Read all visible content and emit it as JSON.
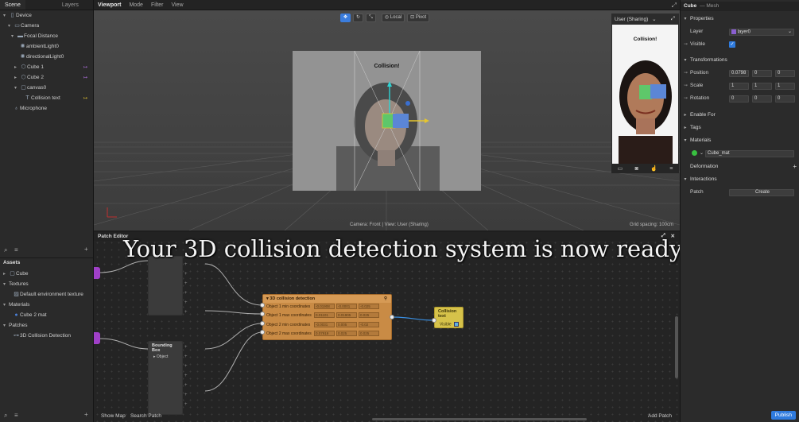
{
  "left": {
    "tabs": [
      "Scene",
      "Layers"
    ],
    "scene_tree": [
      {
        "label": "Device",
        "icon": "device-icon",
        "caret": "▾",
        "badge": ""
      },
      {
        "label": "Camera",
        "icon": "camera-icon",
        "caret": "▾",
        "badge": ""
      },
      {
        "label": "Focal Distance",
        "icon": "focal-icon",
        "caret": "▾",
        "badge": ""
      },
      {
        "label": "ambientLight0",
        "icon": "light-icon",
        "caret": "",
        "badge": ""
      },
      {
        "label": "directionalLight0",
        "icon": "light-icon",
        "caret": "",
        "badge": ""
      },
      {
        "label": "Cube 1",
        "icon": "cube-icon",
        "caret": "▸",
        "badge": "↦"
      },
      {
        "label": "Cube 2",
        "icon": "cube-icon",
        "caret": "▸",
        "badge": "↦"
      },
      {
        "label": "canvas0",
        "icon": "canvas-icon",
        "caret": "▾",
        "badge": ""
      },
      {
        "label": "Collision text",
        "icon": "text-icon",
        "caret": "",
        "badge": "↦"
      },
      {
        "label": "Microphone",
        "icon": "microphone-icon",
        "caret": "",
        "badge": ""
      }
    ],
    "assets_title": "Assets",
    "assets_tree": [
      {
        "label": "Cube",
        "caret": "▸",
        "icon": "folder-icon"
      },
      {
        "label": "Textures",
        "caret": "▾",
        "icon": ""
      },
      {
        "label": "Default environment texture",
        "caret": "",
        "icon": "texture-icon"
      },
      {
        "label": "Materials",
        "caret": "▾",
        "icon": ""
      },
      {
        "label": "Cube 2 mat",
        "caret": "",
        "icon": "material-icon"
      },
      {
        "label": "Patches",
        "caret": "▾",
        "icon": ""
      },
      {
        "label": "3D Collision Detection",
        "caret": "",
        "icon": "patch-icon"
      }
    ]
  },
  "topbar": {
    "menus": [
      "Viewport",
      "Mode",
      "Filter",
      "View"
    ]
  },
  "viewport": {
    "toolbar": {
      "local": "Local",
      "pivot": "Pivot"
    },
    "camera_label": "Collision!",
    "status": "Camera: Front | View: User (Sharing)",
    "grid_spacing": "Grid spacing: 100cm"
  },
  "preview": {
    "device": "User (Sharing)",
    "label": "Collision!"
  },
  "patch": {
    "title": "Patch Editor",
    "caption": "Your 3D collision detection system is now ready!",
    "bounding_box": {
      "title": "Bounding Box",
      "port": "Object"
    },
    "collision_node": {
      "title": "3D collision detection",
      "ports": [
        {
          "label": "Object 1 min coordinates",
          "values": [
            "-0.01908",
            "-0.0001",
            "-0.025"
          ]
        },
        {
          "label": "Object 1 max coordinates",
          "values": [
            "0.01101",
            "0.01905",
            "0.025"
          ]
        },
        {
          "label": "Object 2 min coordinates",
          "values": [
            "-0.0031",
            "0.005",
            "-0.02"
          ]
        },
        {
          "label": "Object 2 max coordinates",
          "values": [
            "0.07919",
            "0.025",
            "0.025"
          ]
        }
      ]
    },
    "collision_text_node": {
      "title": "Collision text",
      "port": "Visible"
    },
    "footer": {
      "show_map": "Show Map",
      "search_patch": "Search Patch",
      "add_patch": "Add Patch"
    }
  },
  "right": {
    "object_name": "Cube",
    "object_type": "— Mesh",
    "sections": {
      "properties": "Properties",
      "transformations": "Transformations",
      "enable_for": "Enable For",
      "tags": "Tags",
      "materials": "Materials",
      "deformation": "Deformation",
      "interactions": "Interactions"
    },
    "layer_label": "Layer",
    "layer_value": "layer0",
    "visible_label": "Visible",
    "position_label": "Position",
    "position": [
      "0.0798",
      "0",
      "0"
    ],
    "scale_label": "Scale",
    "scale": [
      "1",
      "1",
      "1"
    ],
    "rotation_label": "Rotation",
    "rotation": [
      "0",
      "0",
      "0"
    ],
    "material_value": "Cube_mat",
    "patch_label": "Patch",
    "create_label": "Create",
    "publish": "Publish"
  },
  "colors": {
    "accent": "#3b7ddd",
    "node_orange": "#c98b45",
    "node_yellow": "#d6c24a",
    "port_purple": "#a040c8"
  }
}
